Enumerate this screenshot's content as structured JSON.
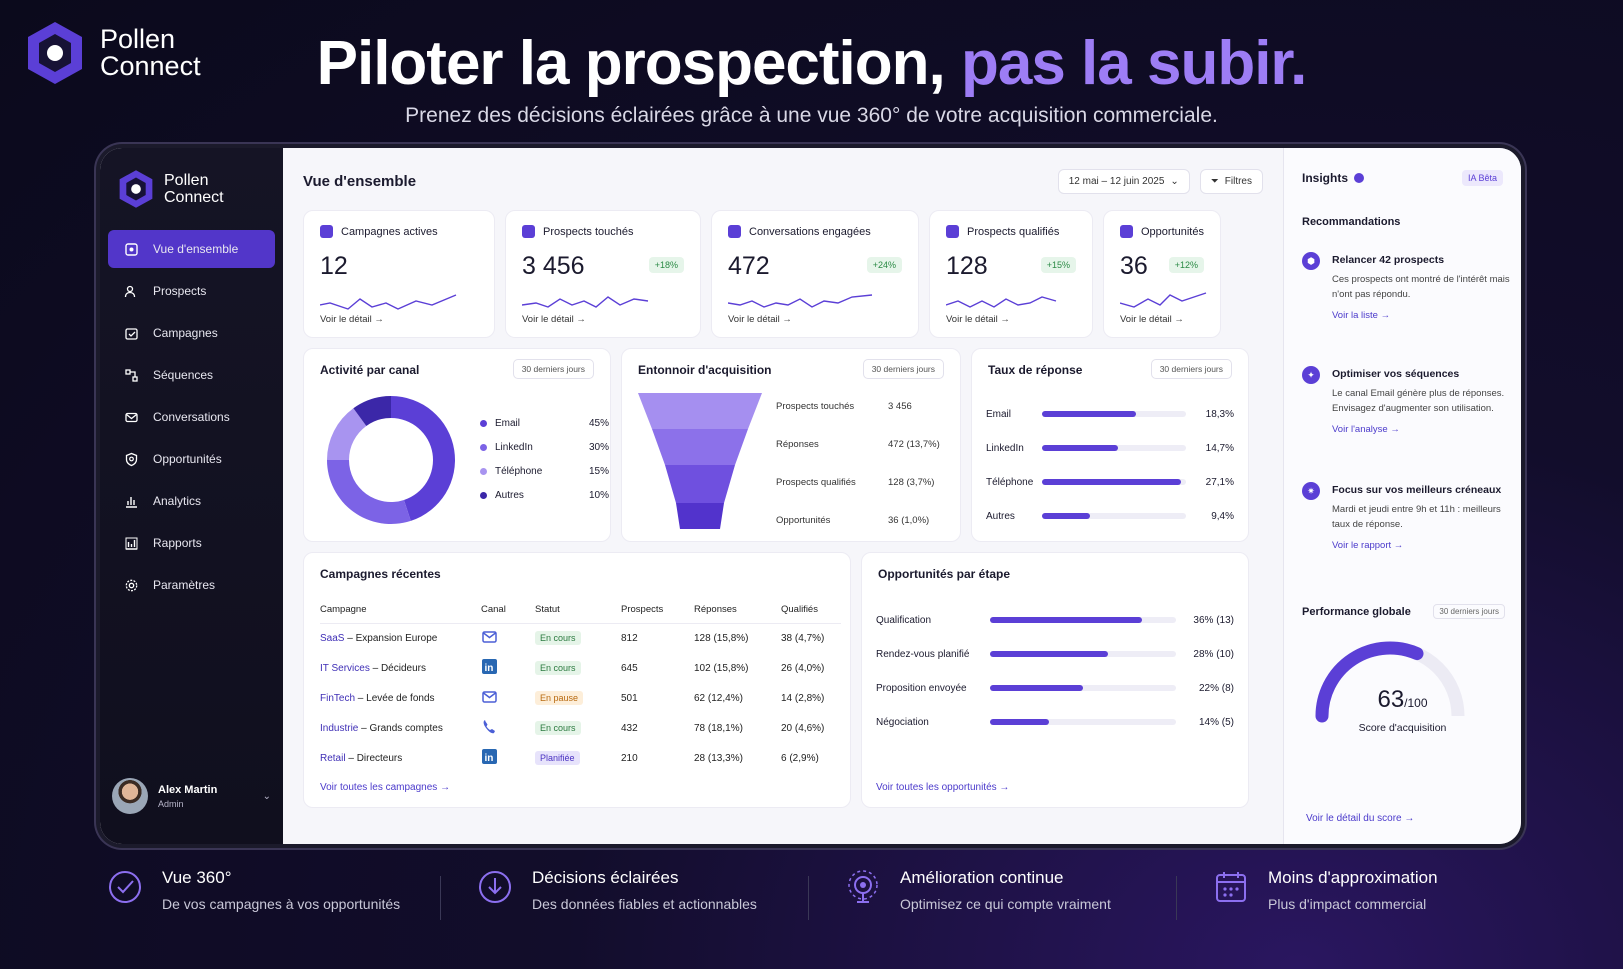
{
  "brand": {
    "line1": "Pollen",
    "line2": "Connect"
  },
  "hero": {
    "title_a": "Piloter la prospection, ",
    "title_b": "pas la subir.",
    "subtitle": "Prenez des décisions éclairées grâce à une vue 360° de votre acquisition commerciale."
  },
  "colors": {
    "accent": "#5b3fd6",
    "accent_light": "#9d7df5",
    "positive": "#2b8a45"
  },
  "sidebar": {
    "items": [
      {
        "label": "Vue d'ensemble",
        "icon": "home-icon",
        "active": true
      },
      {
        "label": "Prospects",
        "icon": "users-icon"
      },
      {
        "label": "Campagnes",
        "icon": "campaign-icon"
      },
      {
        "label": "Séquences",
        "icon": "sequence-icon"
      },
      {
        "label": "Conversations",
        "icon": "mail-icon"
      },
      {
        "label": "Opportunités",
        "icon": "shield-icon"
      },
      {
        "label": "Analytics",
        "icon": "chart-icon"
      },
      {
        "label": "Rapports",
        "icon": "report-icon"
      },
      {
        "label": "Paramètres",
        "icon": "gear-icon"
      }
    ],
    "user": {
      "name": "Alex Martin",
      "role": "Admin"
    }
  },
  "header": {
    "title": "Vue d'ensemble",
    "date_range": "12 mai – 12 juin 2025",
    "filters": "Filtres"
  },
  "kpis": [
    {
      "label": "Campagnes actives",
      "value": "12",
      "badge": "",
      "link": "Voir le détail →"
    },
    {
      "label": "Prospects touchés",
      "value": "3 456",
      "badge": "+18%",
      "link": "Voir le détail →"
    },
    {
      "label": "Conversations engagées",
      "value": "472",
      "badge": "+24%",
      "link": "Voir le détail →"
    },
    {
      "label": "Prospects qualifiés",
      "value": "128",
      "badge": "+15%",
      "link": "Voir le détail →"
    },
    {
      "label": "Opportunités",
      "value": "36",
      "badge": "+12%",
      "link": "Voir le détail →"
    }
  ],
  "activity": {
    "title": "Activité par canal",
    "period": "30 derniers jours",
    "rows": [
      {
        "name": "Email",
        "pct": "45%",
        "color": "#5b3fd6"
      },
      {
        "name": "LinkedIn",
        "pct": "30%",
        "color": "#7c63e6"
      },
      {
        "name": "Téléphone",
        "pct": "15%",
        "color": "#a894f0"
      },
      {
        "name": "Autres",
        "pct": "10%",
        "color": "#3b27a8"
      }
    ]
  },
  "funnel": {
    "title": "Entonnoir d'acquisition",
    "period": "30 derniers jours",
    "rows": [
      {
        "name": "Prospects touchés",
        "value": "3 456"
      },
      {
        "name": "Réponses",
        "value": "472 (13,7%)"
      },
      {
        "name": "Prospects qualifiés",
        "value": "128 (3,7%)"
      },
      {
        "name": "Opportunités",
        "value": "36 (1,0%)"
      }
    ]
  },
  "response": {
    "title": "Taux de réponse",
    "period": "30 derniers jours",
    "rows": [
      {
        "name": "Email",
        "value": "18,3%"
      },
      {
        "name": "LinkedIn",
        "value": "14,7%"
      },
      {
        "name": "Téléphone",
        "value": "27,1%"
      },
      {
        "name": "Autres",
        "value": "9,4%"
      }
    ]
  },
  "campaigns": {
    "title": "Campagnes récentes",
    "headers": [
      "Campagne",
      "Canal",
      "Statut",
      "Prospects",
      "Réponses",
      "Qualifiés"
    ],
    "rows": [
      {
        "sector": "SaaS",
        "rest": " – Expansion Europe",
        "canal": "mail",
        "status": "En cours",
        "sc": "g",
        "prospects": "812",
        "reponses": "128 (15,8%)",
        "qualifies": "38 (4,7%)"
      },
      {
        "sector": "IT Services",
        "rest": " – Décideurs",
        "canal": "linkedin",
        "status": "En cours",
        "sc": "g",
        "prospects": "645",
        "reponses": "102 (15,8%)",
        "qualifies": "26 (4,0%)"
      },
      {
        "sector": "FinTech",
        "rest": " – Levée de fonds",
        "canal": "mail",
        "status": "En pause",
        "sc": "o",
        "prospects": "501",
        "reponses": "62 (12,4%)",
        "qualifies": "14 (2,8%)"
      },
      {
        "sector": "Industrie",
        "rest": " – Grands comptes",
        "canal": "phone",
        "status": "En cours",
        "sc": "g",
        "prospects": "432",
        "reponses": "78 (18,1%)",
        "qualifies": "20 (4,6%)"
      },
      {
        "sector": "Retail",
        "rest": " – Directeurs",
        "canal": "linkedin",
        "status": "Planifiée",
        "sc": "p",
        "prospects": "210",
        "reponses": "28 (13,3%)",
        "qualifies": "6 (2,9%)"
      }
    ],
    "link": "Voir toutes les campagnes →"
  },
  "stages": {
    "title": "Opportunités par étape",
    "rows": [
      {
        "name": "Qualification",
        "value": "36% (13)"
      },
      {
        "name": "Rendez-vous planifié",
        "value": "28% (10)"
      },
      {
        "name": "Proposition envoyée",
        "value": "22% (8)"
      },
      {
        "name": "Négociation",
        "value": "14% (5)"
      }
    ],
    "link": "Voir toutes les opportunités →"
  },
  "insights": {
    "title": "Insights",
    "tag": "IA Bêta",
    "section": "Recommandations",
    "items": [
      {
        "title": "Relancer 42 prospects",
        "desc": "Ces prospects ont montré de l'intérêt mais n'ont pas répondu.",
        "link": "Voir la liste →"
      },
      {
        "title": "Optimiser vos séquences",
        "desc": "Le canal Email génère plus de réponses. Envisagez d'augmenter son utilisation.",
        "link": "Voir l'analyse →"
      },
      {
        "title": "Focus sur vos meilleurs créneaux",
        "desc": "Mardi et jeudi entre 9h et 11h : meilleurs taux de réponse.",
        "link": "Voir le rapport →"
      }
    ],
    "perf_title": "Performance globale",
    "perf_period": "30 derniers jours",
    "score": "63",
    "score_max": "/100",
    "score_label": "Score d'acquisition",
    "score_link": "Voir le détail du score →"
  },
  "features": [
    {
      "title": "Vue 360°",
      "desc": "De vos campagnes à vos opportunités"
    },
    {
      "title": "Décisions éclairées",
      "desc": "Des données fiables et actionnables"
    },
    {
      "title": "Amélioration continue",
      "desc": "Optimisez ce qui compte vraiment"
    },
    {
      "title": "Moins d'approximation",
      "desc": "Plus d'impact commercial"
    }
  ],
  "chart_data": [
    {
      "type": "pie",
      "title": "Activité par canal",
      "categories": [
        "Email",
        "LinkedIn",
        "Téléphone",
        "Autres"
      ],
      "values": [
        45,
        30,
        15,
        10
      ]
    },
    {
      "type": "bar",
      "title": "Taux de réponse",
      "categories": [
        "Email",
        "LinkedIn",
        "Téléphone",
        "Autres"
      ],
      "values": [
        18.3,
        14.7,
        27.1,
        9.4
      ]
    },
    {
      "type": "bar",
      "title": "Opportunités par étape",
      "categories": [
        "Qualification",
        "Rendez-vous planifié",
        "Proposition envoyée",
        "Négociation"
      ],
      "values": [
        36,
        28,
        22,
        14
      ]
    },
    {
      "type": "bar",
      "title": "Entonnoir d'acquisition",
      "categories": [
        "Prospects touchés",
        "Réponses",
        "Prospects qualifiés",
        "Opportunités"
      ],
      "values": [
        3456,
        472,
        128,
        36
      ]
    }
  ]
}
